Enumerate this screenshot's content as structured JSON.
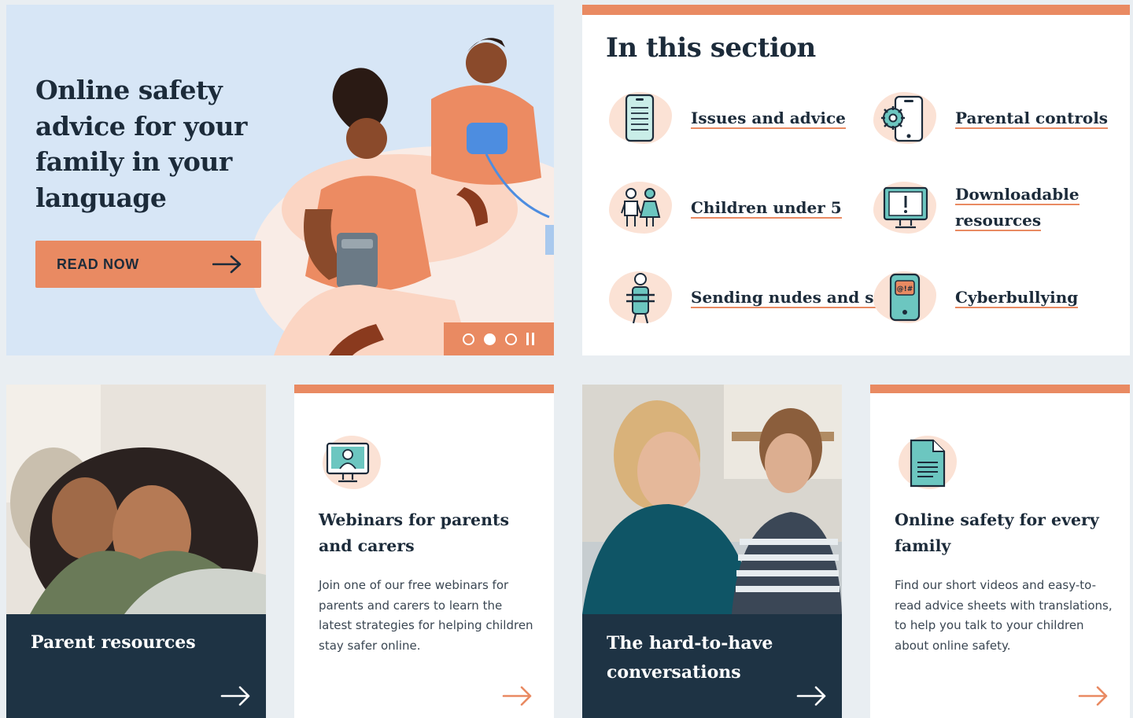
{
  "hero": {
    "title": "Online safety advice for your family in your language",
    "cta_label": "READ NOW",
    "carousel": {
      "slides": 3,
      "active_slide": 2
    }
  },
  "in_this_section": {
    "heading": "In this section",
    "items": [
      {
        "label": "Issues and advice",
        "icon": "phone-list-icon"
      },
      {
        "label": "Parental controls",
        "icon": "phone-gear-icon"
      },
      {
        "label": "Children under 5",
        "icon": "two-children-icon"
      },
      {
        "label": "Downloadable resources",
        "icon": "monitor-alert-icon"
      },
      {
        "label": "Sending nudes and sexting",
        "icon": "person-phone-icon"
      },
      {
        "label": "Cyberbullying",
        "icon": "phone-speech-icon"
      }
    ]
  },
  "cards": {
    "parent_resources": {
      "title": "Parent resources"
    },
    "webinars": {
      "title": "Webinars for parents and carers",
      "body": "Join one of our free webinars for parents and carers to learn the latest strategies for helping children stay safer online."
    },
    "conversations": {
      "title": "The hard-to-have conversations"
    },
    "every_family": {
      "title": "Online safety for every family",
      "body": "Find our short videos and easy-to-read advice sheets with translations, to help you talk to your children about online safety."
    }
  },
  "colors": {
    "accent": "#e98a62",
    "navy": "#1e3344",
    "hero_bg": "#d7e6f6",
    "page_bg": "#e9eef2"
  }
}
